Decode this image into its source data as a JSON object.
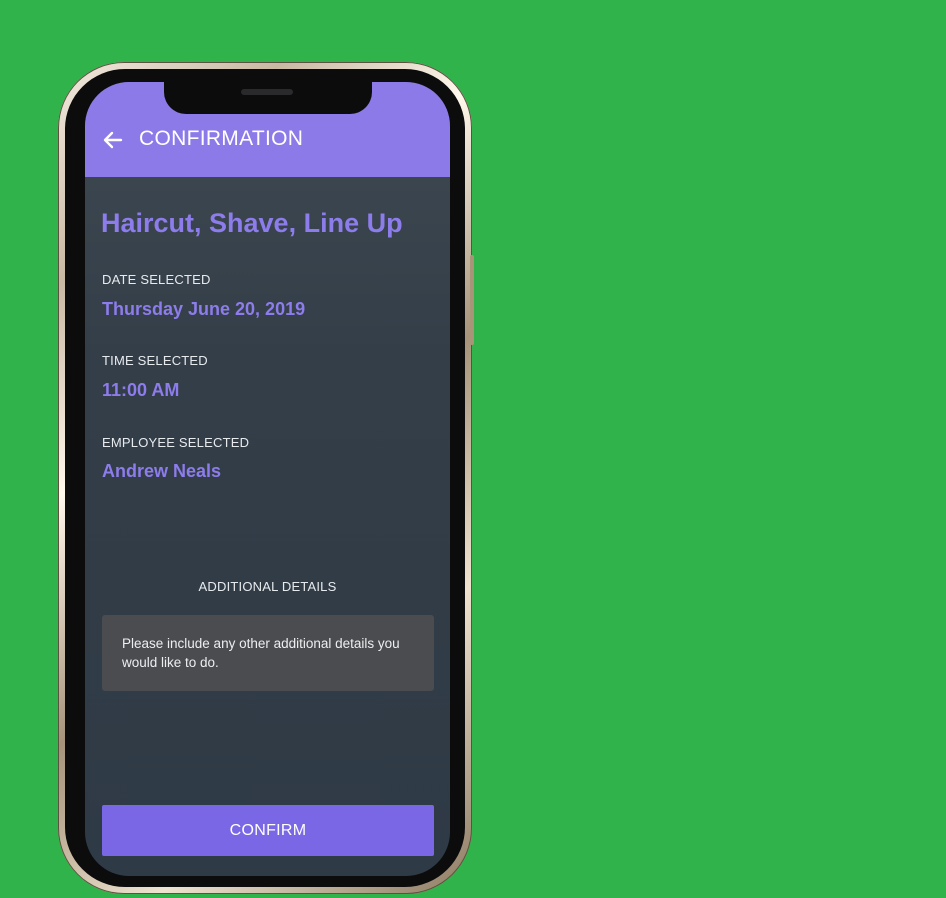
{
  "header": {
    "back_icon": "arrow-left-icon",
    "title": "CONFIRMATION"
  },
  "booking": {
    "service": "Haircut, Shave, Line Up",
    "date_label": "DATE SELECTED",
    "date_value": "Thursday June 20, 2019",
    "time_label": "TIME SELECTED",
    "time_value": "11:00 AM",
    "employee_label": "EMPLOYEE SELECTED",
    "employee_value": "Andrew Neals"
  },
  "details": {
    "heading": "ADDITIONAL DETAILS",
    "placeholder": "Please include any other additional details you would like to do."
  },
  "actions": {
    "confirm_label": "CONFIRM"
  },
  "colors": {
    "background": "#2fb34a",
    "accent": "#8b7ae8",
    "button": "#7a67e6",
    "screen": "#343e48"
  }
}
